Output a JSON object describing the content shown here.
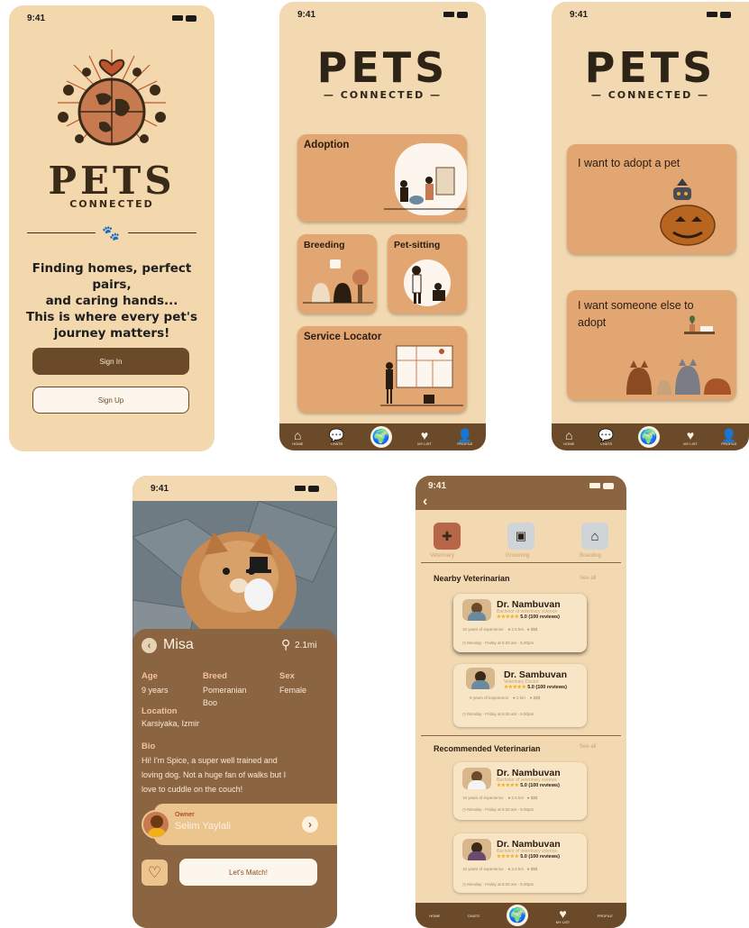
{
  "status_time": "9:41",
  "app": {
    "title": "PETS",
    "subtitle": "CONNECTED"
  },
  "landing": {
    "tagline_1": "Finding homes, perfect pairs,",
    "tagline_2": "and caring hands...",
    "tagline_3": "This is where every pet's",
    "tagline_4": "journey matters!",
    "sign_in": "Sign In",
    "sign_up": "Sign Up"
  },
  "menu": {
    "adoption": "Adoption",
    "breeding": "Breeding",
    "pet_sitting": "Pet-sitting",
    "service_locator": "Service Locator"
  },
  "choice": {
    "adopt": "I want to adopt a pet",
    "rehome_1": "I want someone else to",
    "rehome_2": "adopt"
  },
  "nav": {
    "home": "HOME",
    "chats": "CHATS",
    "my_list": "MY LIST",
    "profile": "PROFILE"
  },
  "pet": {
    "name": "Misa",
    "distance": "2.1mi",
    "age_label": "Age",
    "age": "9 years",
    "breed_label": "Breed",
    "breed_1": "Pomeranian",
    "breed_2": "Boo",
    "sex_label": "Sex",
    "sex": "Female",
    "location_label": "Location",
    "location": "Karsiyaka, Izmir",
    "bio_label": "Bio",
    "bio_1": "Hi! I'm Spice, a super well trained and",
    "bio_2": "loving dog. Not a huge fan of walks but I",
    "bio_3": "love to cuddle on the couch!",
    "owner_label": "Owner",
    "owner": "Selim Yaylali",
    "match": "Let's Match!"
  },
  "services": {
    "categories": [
      "Veterinary",
      "Grooming",
      "Boarding"
    ],
    "nearby_title": "Nearby Veterinarian",
    "recommended_title": "Recommended Veterinarian",
    "see_all": "See all",
    "vets": [
      {
        "name": "Dr. Nambuvan",
        "degree": "Bachelor of veterinary science",
        "rating": "5.0 (100 reviews)",
        "experience": "10 years of experience",
        "distance": "2.5 km",
        "price": "$$$",
        "hours": "Monday - Friday at 8.00 am - 5.00pm"
      },
      {
        "name": "Dr. Sambuvan",
        "degree": "Veterinary Doctor",
        "rating": "5.0 (100 reviews)",
        "experience": "9 years of experience",
        "distance": "2 km",
        "price": "$$$",
        "hours": "Monday - Friday at 8.00 am - 5.00pm"
      },
      {
        "name": "Dr. Nambuvan",
        "degree": "Bachelor of veterinary science",
        "rating": "5.0 (100 reviews)",
        "experience": "10 years of experience",
        "distance": "2.5 km",
        "price": "$$$",
        "hours": "Monday - Friday at 8.00 am - 5.00pm"
      },
      {
        "name": "Dr. Nambuvan",
        "degree": "Bachelor of veterinary science",
        "rating": "5.0 (100 reviews)",
        "experience": "10 years of experience",
        "distance": "2.5 km",
        "price": "$$$",
        "hours": "Monday - Friday at 8.00 am - 5.00pm"
      }
    ]
  },
  "colors": {
    "background": "#f3d9b1",
    "brown": "#6b4a2a",
    "card": "#e2a673",
    "profile_bg": "#8b6442"
  }
}
